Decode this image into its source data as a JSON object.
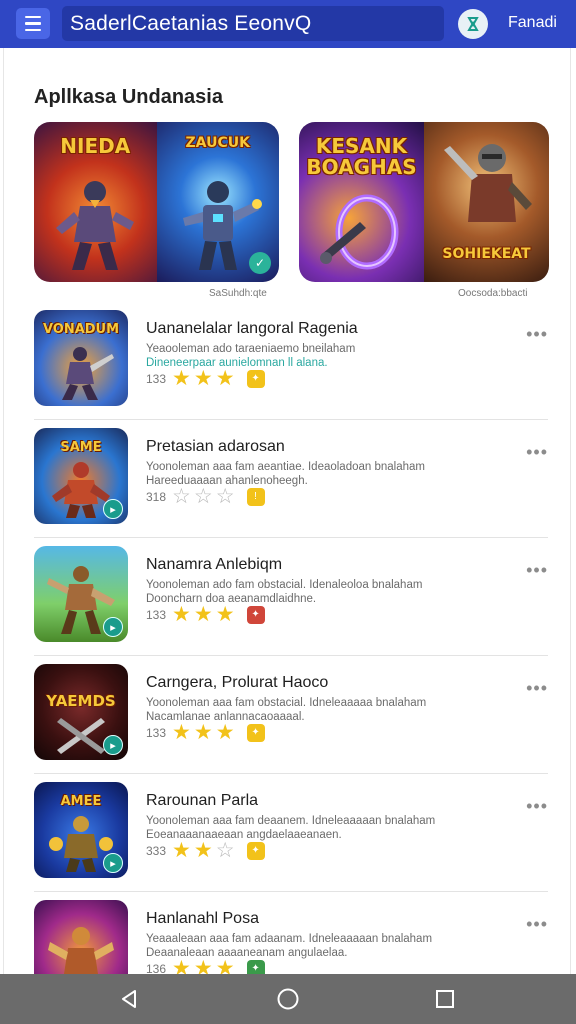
{
  "topbar": {
    "search_text": "SaderlCaetanias EeonvQ",
    "right_label": "Fanadi"
  },
  "section": {
    "title": "Apllkasa Undanasia"
  },
  "featured": [
    {
      "tiles": [
        "NIEDA",
        "ZAUCUK"
      ],
      "caption": "SaSuhdh:qte"
    },
    {
      "tiles": [
        "KESANK BOAGHAS",
        "SOHIEKEAT"
      ],
      "caption": "Oocsoda:bbacti"
    }
  ],
  "apps": [
    {
      "icon_title": "VONADUM",
      "name": "Uananelalar langoral Ragenia",
      "desc1": "Yeaooleman ado taraeniaemo bneilaham",
      "desc2": "Dineneerpaar aunielomnan ll alana.",
      "count": "133",
      "rating": 3
    },
    {
      "icon_title": "SAME",
      "name": "Pretasian adarosan",
      "desc1": "Yoonoleman aaa fam aeantiae. Ideaoladoan bnalaham",
      "desc2": "Hareeduaaaan ahanlenoheegh.",
      "count": "318",
      "rating": 0
    },
    {
      "icon_title": "",
      "name": "Nanamra Anlebiqm",
      "desc1": "Yoonoleman ado fam obstacial. Idenaleoloa bnalaham",
      "desc2": "Dooncharn doa aeanamdlaidhne.",
      "count": "133",
      "rating": 3
    },
    {
      "icon_title": "YAEMDS",
      "name": "Carngera, Prolurat Haoco",
      "desc1": "Yoonoleman aaa fam obstacial. Idneleaaaaa bnalaham",
      "desc2": "Nacamlanae anlannacaoaaaal.",
      "count": "133",
      "rating": 3
    },
    {
      "icon_title": "AMEE",
      "name": "Rarounan Parla",
      "desc1": "Yoonoleman aaa fam deaanem. Idneleaaaaan bnalaham",
      "desc2": "Eoeanaaanaaeaan angdaelaaeanaen.",
      "count": "333",
      "rating": 2
    },
    {
      "icon_title": "",
      "name": "Hanlanahl Posa",
      "desc1": "Yeaaaleaan aaa fam adaanam. Idneleaaaaan bnalaham",
      "desc2": "Deaanaleaan aaaaneanam angulaelaa.",
      "count": "136",
      "rating": 3
    }
  ],
  "colors": {
    "topbar": "#2f47c4",
    "star": "#f2c21a",
    "navbar": "#6b6b6b"
  }
}
